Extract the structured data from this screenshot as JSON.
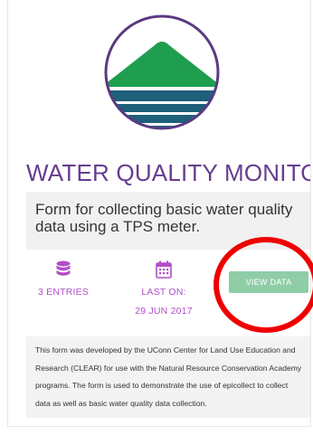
{
  "project": {
    "title": "WATER QUALITY MONITO...",
    "short_description": "Form for collecting basic water quality data using a TPS meter.",
    "long_description": "This form was developed by the UConn Center for Land Use Education and Research (CLEAR) for use with the Natural Resource Conservation Academy programs. The form is used to demonstrate the use of epicollect to collect data as well as basic water quality data collection."
  },
  "stats": {
    "entries_label": "3 ENTRIES",
    "entries_icon": "database-icon",
    "last_on_label": "LAST ON:",
    "last_on_date": "29 JUN 2017",
    "last_on_icon": "calendar-icon"
  },
  "actions": {
    "view_data_label": "VIEW DATA"
  },
  "logo": {
    "icon": "mountain-water-logo",
    "colors": {
      "ring": "#5a3a82",
      "land": "#1f9e4f",
      "water": "#1e5f7a"
    }
  },
  "colors": {
    "title": "#673c8e",
    "stat_accent": "#b04fc7",
    "button": "#8fcda7",
    "annotation_ring": "#ee0000"
  }
}
